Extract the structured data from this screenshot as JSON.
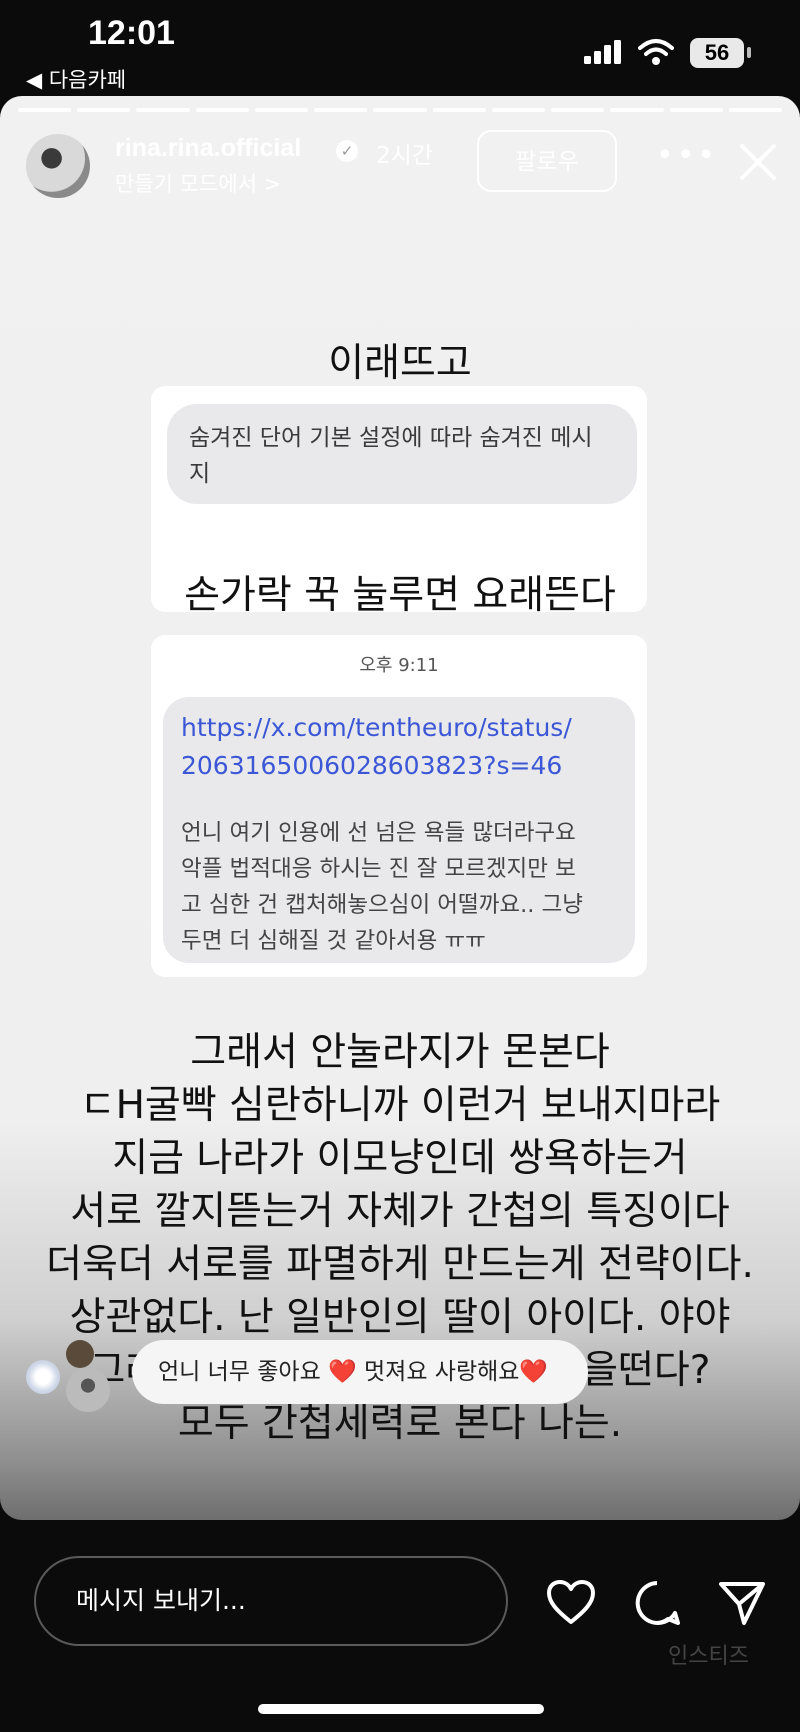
{
  "status_bar": {
    "time": "12:01",
    "back_app": "◀ 다음카페",
    "battery": "56"
  },
  "story": {
    "segments": 13,
    "username": "rina.rina.official",
    "time_ago": "2시간",
    "subline": "만들기 모드에서 >",
    "follow_label": "팔로우",
    "more_label": "•••"
  },
  "content": {
    "caption1": "이래뜨고",
    "hidden_message": [
      "숨겨진 단어 기본 설정에 따라 숨겨진 메시",
      "지"
    ],
    "caption2": "손가락 꾹 눌루면 요래뜬다",
    "msg_time": "오후 9:11",
    "link_lines": [
      "https://x.com/tentheuro/status/",
      "2063165006028603823?s=46"
    ],
    "msg_lines": [
      "언니 여기 인용에 선 넘은 욕들 많더라구요",
      "악플 법적대응 하시는 진 잘 모르겠지만 보",
      "고 심한 건 캡처해놓으심이 어떨까요.. 그냥",
      "두면 더 심해질 것 같아서용 ㅠㅠ"
    ],
    "poem_lines": [
      "그래서 안눌라지가 몬본다",
      "ㄷH굴빡 심란하니까 이런거 보내지마라",
      "지금 나라가 이모냥인데 쌍욕하는거",
      "서로 깔지뜯는거 자체가 간첩의 특징이다",
      "더욱더 서로를 파멸하게 만드는게 전략이다.",
      "상관없다. 난 일반인의 딸이 아이다. 야야",
      "그래서 난 지금 이 시국에 육갑을떤다?",
      "모두 간첩세력로 본다 나는."
    ]
  },
  "reply": {
    "text": "언니 너무 좋아요 ❤️ 멋져요 사랑해요❤️"
  },
  "bottom": {
    "placeholder": "메시지 보내기...",
    "watermark": "인스티즈"
  }
}
